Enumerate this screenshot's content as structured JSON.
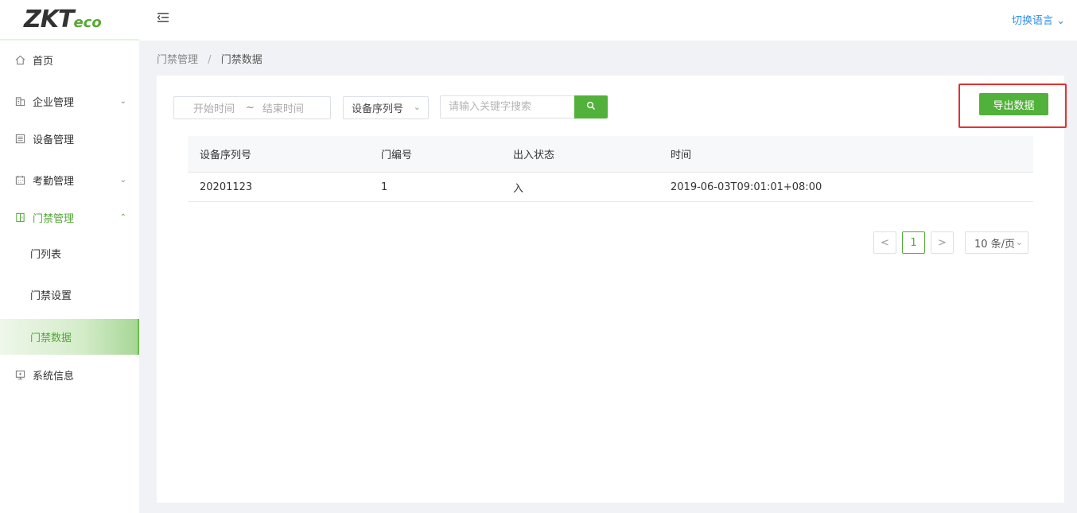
{
  "app": {
    "logo_main": "ZKT",
    "logo_sub": "eco"
  },
  "header": {
    "language_label": "切换语言"
  },
  "sidebar": {
    "items": [
      {
        "label": "首页",
        "icon": "home-icon"
      },
      {
        "label": "企业管理",
        "icon": "building-icon"
      },
      {
        "label": "设备管理",
        "icon": "device-icon"
      },
      {
        "label": "考勤管理",
        "icon": "calendar-icon"
      },
      {
        "label": "门禁管理",
        "icon": "door-icon"
      },
      {
        "label": "系统信息",
        "icon": "monitor-icon"
      }
    ],
    "sub_items": [
      {
        "label": "门列表"
      },
      {
        "label": "门禁设置"
      },
      {
        "label": "门禁数据"
      }
    ]
  },
  "breadcrumb": {
    "parent": "门禁管理",
    "separator": "/",
    "current": "门禁数据"
  },
  "filters": {
    "start_placeholder": "开始时间",
    "range_sep": "~",
    "end_placeholder": "结束时间",
    "serial_select": "设备序列号",
    "keyword_placeholder": "请输入关键字搜索"
  },
  "toolbar": {
    "export_label": "导出数据"
  },
  "table": {
    "headers": [
      "设备序列号",
      "门编号",
      "出入状态",
      "时间"
    ],
    "rows": [
      [
        "20201123",
        "1",
        "入",
        "2019-06-03T09:01:01+08:00"
      ]
    ]
  },
  "pagination": {
    "prev": "<",
    "current_page": "1",
    "next": ">",
    "page_size": "10 条/页"
  },
  "colors": {
    "accent": "#52b13a",
    "highlight": "#e5312e",
    "link": "#2d8cf0"
  }
}
